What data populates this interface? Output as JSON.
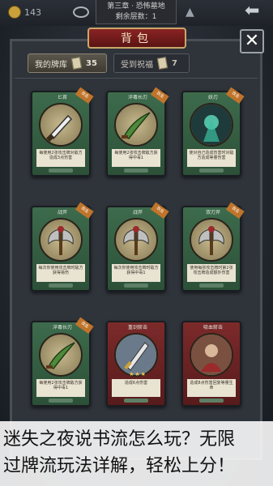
{
  "topbar": {
    "gold_count": "143",
    "chapter_title": "第三章 · 恐怖墓地",
    "remaining": "剩余层数：1"
  },
  "panel": {
    "title": "背包",
    "close_label": "✕"
  },
  "tabs": [
    {
      "label": "我的牌库",
      "count": "35"
    },
    {
      "label": "受到祝福",
      "count": "7"
    }
  ],
  "cards": [
    {
      "name": "匕首",
      "text": "每使用2张攻击牌对敌方造成3点伤害",
      "ribbon": "攻击",
      "color": "green"
    },
    {
      "name": "淬毒长刃",
      "text": "每使用2张攻击牌敌方获得中毒1",
      "ribbon": "攻击",
      "color": "green"
    },
    {
      "name": "妖刃",
      "text": "使对自己造成伤害时对敌方造成等量伤害",
      "ribbon": "攻击",
      "color": "green"
    },
    {
      "name": "战斧",
      "text": "每次你使用攻击牌时敌方获得易伤",
      "ribbon": "攻击",
      "color": "green"
    },
    {
      "name": "战斧",
      "text": "每次你使用攻击牌时敌方获得中毒1",
      "ribbon": "攻击",
      "color": "green"
    },
    {
      "name": "双刃斧",
      "text": "使用每张攻击牌时第2张攻击牌造成额外伤害",
      "ribbon": "攻击",
      "color": "green"
    },
    {
      "name": "淬毒长刃",
      "text": "每使用2张攻击牌敌方获得中毒1",
      "ribbon": "攻击",
      "color": "green"
    },
    {
      "name": "重剑斩击",
      "text": "造成6点伤害",
      "ribbon": "",
      "color": "red",
      "stars": "★★★"
    },
    {
      "name": "吸血斩击",
      "text": "造成8点伤害回复等量生命",
      "ribbon": "",
      "color": "red"
    }
  ],
  "caption": {
    "line1": "迷失之夜说书流怎么玩？无限",
    "line2": "过牌流玩法详解，轻松上分！"
  }
}
